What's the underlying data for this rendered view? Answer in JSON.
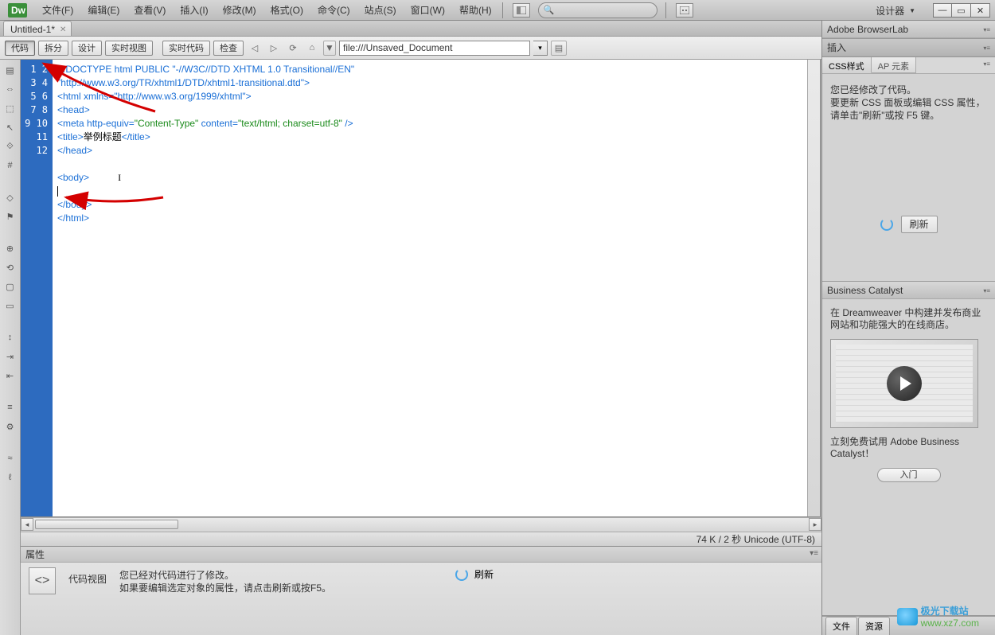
{
  "menu": {
    "items": [
      "文件(F)",
      "编辑(E)",
      "查看(V)",
      "插入(I)",
      "修改(M)",
      "格式(O)",
      "命令(C)",
      "站点(S)",
      "窗口(W)",
      "帮助(H)"
    ],
    "designer": "设计器"
  },
  "window": {
    "dash": "—",
    "box": "▭",
    "x": "X"
  },
  "doc_tab": "Untitled-1*",
  "toolbar": {
    "code": "代码",
    "split": "拆分",
    "design": "设计",
    "live_view": "实时视图",
    "live_code": "实时代码",
    "inspect": "检查",
    "url_prefix": "▼",
    "url": "file:///Unsaved_Document"
  },
  "code": {
    "lines": [
      "1",
      "2",
      "3",
      "4",
      "5",
      "6",
      "7",
      "8",
      "9",
      "10",
      "11",
      "12"
    ],
    "l1": "<!DOCTYPE html PUBLIC \"-//W3C//DTD XHTML 1.0 Transitional//EN\"",
    "l1b": "\"http://www.w3.org/TR/xhtml1/DTD/xhtml1-transitional.dtd\">",
    "l2": "<html xmlns=\"http://www.w3.org/1999/xhtml\">",
    "l3": "<head>",
    "l4a": "<meta http-equiv=",
    "l4b": "\"Content-Type\"",
    "l4c": " content=",
    "l4d": "\"text/html; charset=utf-8\"",
    "l4e": " />",
    "l5a": "<title>",
    "l5b": "举例标题",
    "l5c": "</title>",
    "l6": "</head>",
    "l8": "<body>",
    "l10": "</body>",
    "l11": "</html>"
  },
  "status": "74 K / 2 秒 Unicode (UTF-8)",
  "props": {
    "title": "属性",
    "label": "代码视图",
    "msg1": "您已经对代码进行了修改。",
    "msg2": "如果要编辑选定对象的属性，请点击刷新或按F5。",
    "refresh": "刷新"
  },
  "right": {
    "browserlab": "Adobe BrowserLab",
    "insert": "插入",
    "css_tab": "CSS样式",
    "ap_tab": "AP 元素",
    "css_msg1": "您已经修改了代码。",
    "css_msg2": "要更新 CSS 面板或编辑 CSS 属性，请单击\"刷新\"或按 F5 键。",
    "css_refresh": "刷新",
    "biz_title": "Business Catalyst",
    "biz_msg": "在 Dreamweaver 中构建并发布商业网站和功能强大的在线商店。",
    "biz_cta": "立刻免费试用 Adobe Business Catalyst！",
    "biz_btn": "入门",
    "btab1": "文件",
    "btab2": "资源"
  },
  "watermark": {
    "line1": "极光下载站",
    "line2": "www.xz7.com"
  }
}
